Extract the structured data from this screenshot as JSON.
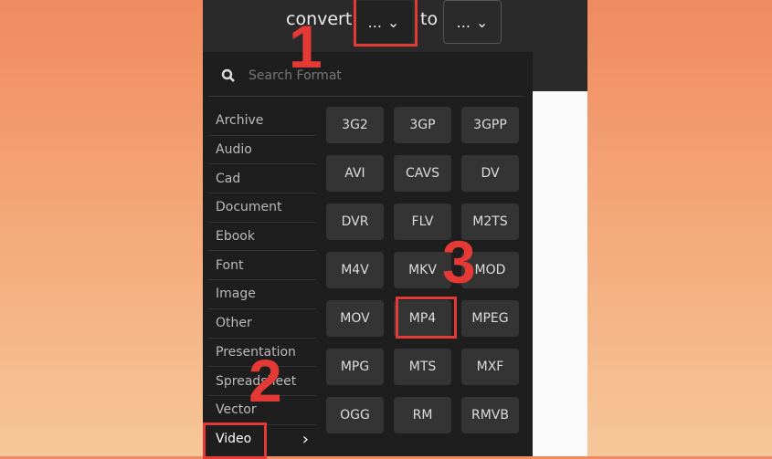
{
  "header": {
    "convert_label": "convert",
    "to_label": "to",
    "from_select": "...",
    "to_select": "..."
  },
  "search": {
    "placeholder": "Search Format",
    "icon": "search-icon"
  },
  "categories": [
    "Archive",
    "Audio",
    "Cad",
    "Document",
    "Ebook",
    "Font",
    "Image",
    "Other",
    "Presentation",
    "Spreadsheet",
    "Vector",
    "Video"
  ],
  "active_category": "Video",
  "formats": [
    "3G2",
    "3GP",
    "3GPP",
    "AVI",
    "CAVS",
    "DV",
    "DVR",
    "FLV",
    "M2TS",
    "M4V",
    "MKV",
    "MOD",
    "MOV",
    "MP4",
    "MPEG",
    "MPG",
    "MTS",
    "MXF",
    "OGG",
    "RM",
    "RMVB"
  ],
  "annotations": {
    "step1": "1",
    "step2": "2",
    "step3": "3",
    "color": "#e53935"
  }
}
